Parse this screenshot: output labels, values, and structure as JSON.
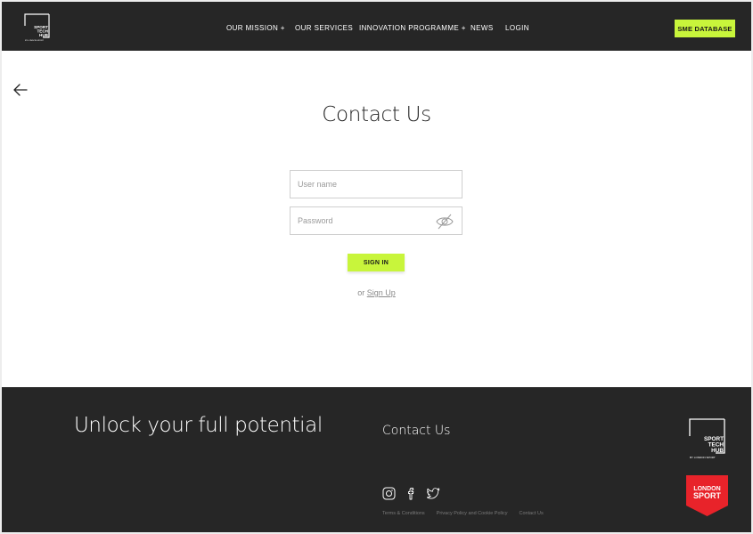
{
  "brand": {
    "logo_lines": [
      "SPORT",
      "TECH",
      "HUB"
    ],
    "logo_subline": "BY LONDON SPORT",
    "accent_color": "#c8f53b",
    "dark_color": "#262626"
  },
  "nav": {
    "items": [
      {
        "label": "OUR MISSION  +"
      },
      {
        "label": "OUR SERVICES"
      },
      {
        "label": "INNOVATION PROGRAMME +"
      },
      {
        "label": "NEWS"
      },
      {
        "label": "LOGIN"
      }
    ],
    "cta_label": "SME DATABASE"
  },
  "main": {
    "back_icon": "arrow-left-icon",
    "title": "Contact Us",
    "username_placeholder": "User name",
    "password_placeholder": "Password",
    "password_toggle_icon": "eye-off-icon",
    "signin_label": "SIGN IN",
    "or_text": "or ",
    "signup_label": "Sign Up"
  },
  "footer": {
    "tagline": "Unlock your full potential",
    "contact_label": "Contact Us",
    "social_icons": [
      "instagram-icon",
      "facebook-icon",
      "twitter-icon"
    ],
    "legal_links": [
      "Terms & Conditions",
      "Privacy Policy and Cookie Policy",
      "Contact Us"
    ],
    "partner_lines": [
      "LONDON",
      "SPORT"
    ],
    "partner_color": "#e8232a"
  }
}
